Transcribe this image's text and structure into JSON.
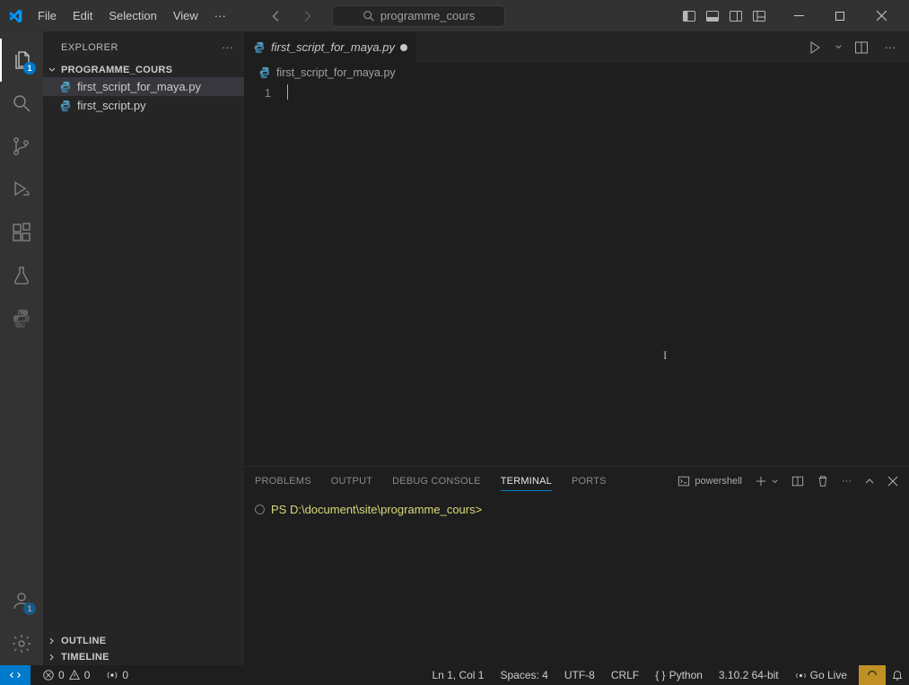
{
  "menu": {
    "file": "File",
    "edit": "Edit",
    "selection": "Selection",
    "view": "View"
  },
  "search": {
    "text": "programme_cours"
  },
  "sidebar": {
    "title": "EXPLORER",
    "root_folder": "PROGRAMME_COURS",
    "files": [
      {
        "name": "first_script_for_maya.py"
      },
      {
        "name": "first_script.py"
      }
    ],
    "outline": "OUTLINE",
    "timeline": "TIMELINE"
  },
  "activity": {
    "explorer_badge": "1",
    "accounts_badge": "1"
  },
  "tab": {
    "name": "first_script_for_maya.py"
  },
  "breadcrumb": {
    "file": "first_script_for_maya.py"
  },
  "editor": {
    "line_no": "1"
  },
  "panel": {
    "tabs": {
      "problems": "PROBLEMS",
      "output": "OUTPUT",
      "debug": "DEBUG CONSOLE",
      "terminal": "TERMINAL",
      "ports": "PORTS"
    },
    "shell": "powershell",
    "prompt_prefix": "PS ",
    "prompt_path": "D:\\document\\site\\programme_cours",
    "prompt_suffix": ">"
  },
  "status": {
    "errors": "0",
    "warnings": "0",
    "ports": "0",
    "ln_col": "Ln 1, Col 1",
    "spaces": "Spaces: 4",
    "encoding": "UTF-8",
    "eol": "CRLF",
    "lang": "Python",
    "interpreter": "3.10.2 64-bit",
    "golive": "Go Live"
  }
}
